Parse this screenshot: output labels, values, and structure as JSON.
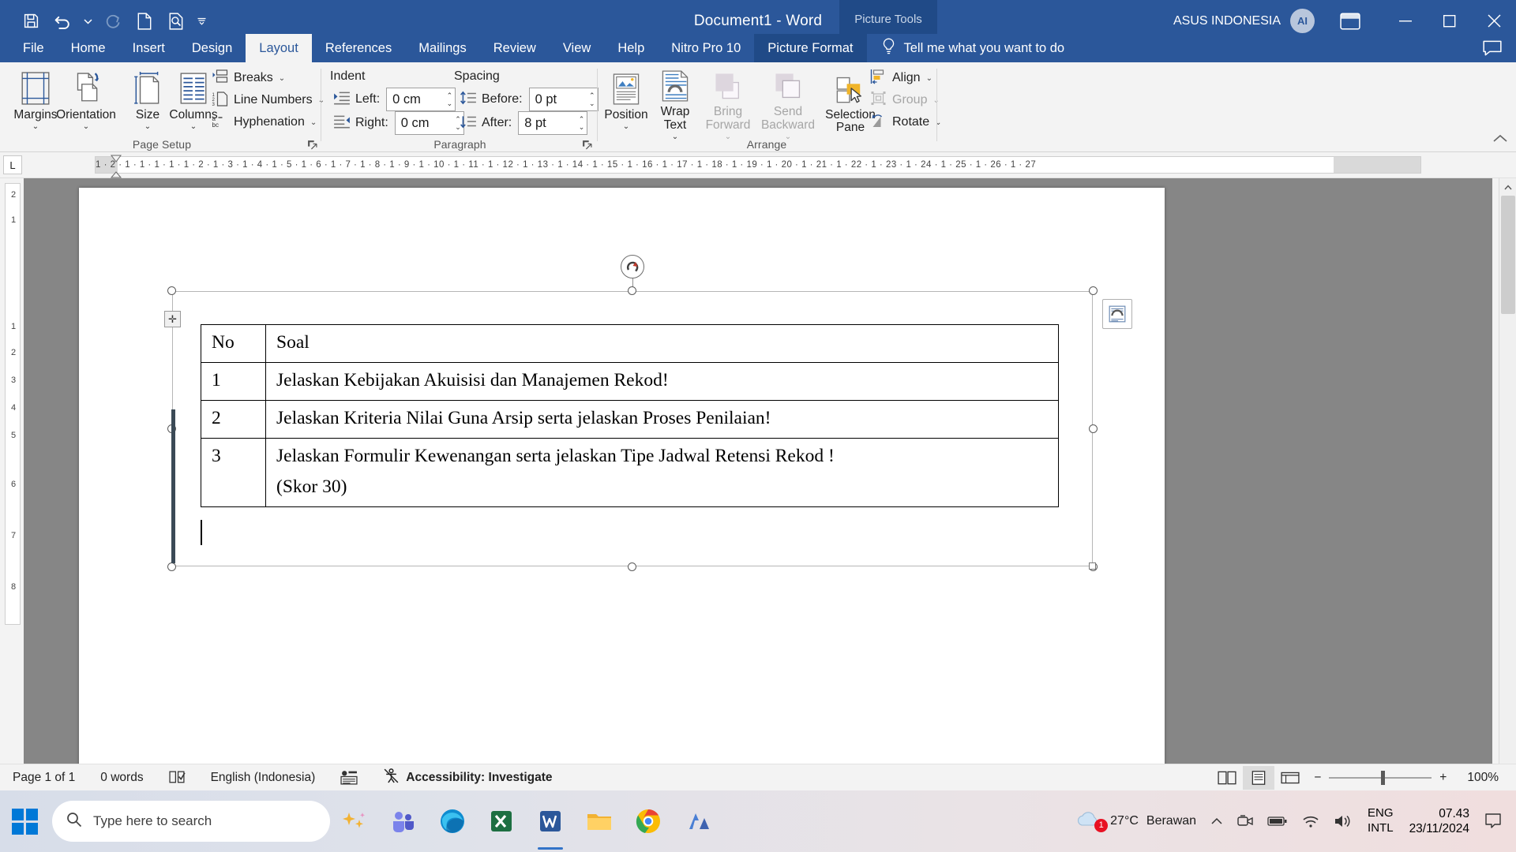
{
  "titlebar": {
    "document_title": "Document1  -  Word",
    "context_tool_label": "Picture Tools",
    "account_name": "ASUS INDONESIA",
    "avatar_initials": "AI",
    "quick_access": [
      {
        "name": "save-icon",
        "label": "Save"
      },
      {
        "name": "undo-icon",
        "label": "Undo"
      },
      {
        "name": "undo-dropdown-icon",
        "label": "Undo options"
      },
      {
        "name": "redo-icon",
        "label": "Redo"
      },
      {
        "name": "new-document-icon",
        "label": "New"
      },
      {
        "name": "print-preview-icon",
        "label": "Print Preview and Print"
      },
      {
        "name": "customize-qat-icon",
        "label": "Customize Quick Access Toolbar"
      }
    ],
    "ribbon_display_options": "Ribbon Display Options",
    "minimize": "Minimize",
    "restore": "Restore Down",
    "close": "Close"
  },
  "tabs": [
    {
      "label": "File",
      "active": false,
      "contextual": false
    },
    {
      "label": "Home",
      "active": false,
      "contextual": false
    },
    {
      "label": "Insert",
      "active": false,
      "contextual": false
    },
    {
      "label": "Design",
      "active": false,
      "contextual": false
    },
    {
      "label": "Layout",
      "active": true,
      "contextual": false
    },
    {
      "label": "References",
      "active": false,
      "contextual": false
    },
    {
      "label": "Mailings",
      "active": false,
      "contextual": false
    },
    {
      "label": "Review",
      "active": false,
      "contextual": false
    },
    {
      "label": "View",
      "active": false,
      "contextual": false
    },
    {
      "label": "Help",
      "active": false,
      "contextual": false
    },
    {
      "label": "Nitro Pro 10",
      "active": false,
      "contextual": false
    },
    {
      "label": "Picture Format",
      "active": false,
      "contextual": true
    }
  ],
  "tell_me": {
    "label": "Tell me what you want to do",
    "icon": "lightbulb-icon"
  },
  "comments": {
    "label": "Comments",
    "icon": "comment-icon"
  },
  "ribbon": {
    "groups": [
      {
        "name": "Page Setup",
        "title": "Page Setup",
        "big_buttons": [
          {
            "label": "Margins",
            "icon": "margins-icon",
            "has_chevron": true,
            "disabled": false
          },
          {
            "label": "Orientation",
            "icon": "orientation-icon",
            "has_chevron": true,
            "disabled": false
          },
          {
            "label": "Size",
            "icon": "page-size-icon",
            "has_chevron": true,
            "disabled": false
          },
          {
            "label": "Columns",
            "icon": "columns-icon",
            "has_chevron": true,
            "disabled": false
          }
        ],
        "small_buttons": [
          {
            "label": "Breaks",
            "icon": "breaks-icon",
            "has_chevron": true,
            "disabled": false
          },
          {
            "label": "Line Numbers",
            "icon": "line-numbers-icon",
            "has_chevron": true,
            "disabled": false
          },
          {
            "label": "Hyphenation",
            "icon": "hyphenation-icon",
            "has_chevron": true,
            "disabled": false
          }
        ]
      },
      {
        "name": "Paragraph",
        "title": "Paragraph",
        "sections": [
          "Indent",
          "Spacing"
        ],
        "fields": [
          {
            "label": "Left:",
            "value": "0 cm",
            "icon": "indent-left-icon"
          },
          {
            "label": "Right:",
            "value": "0 cm",
            "icon": "indent-right-icon"
          },
          {
            "label": "Before:",
            "value": "0 pt",
            "icon": "spacing-before-icon"
          },
          {
            "label": "After:",
            "value": "8 pt",
            "icon": "spacing-after-icon"
          }
        ]
      },
      {
        "name": "Arrange",
        "title": "Arrange",
        "big_buttons": [
          {
            "label": "Position",
            "icon": "position-icon",
            "has_chevron": true,
            "disabled": false
          },
          {
            "label": "Wrap Text",
            "icon": "wrap-text-icon",
            "has_chevron": true,
            "disabled": false
          },
          {
            "label": "Bring Forward",
            "icon": "bring-forward-icon",
            "has_chevron": true,
            "disabled": true
          },
          {
            "label": "Send Backward",
            "icon": "send-backward-icon",
            "has_chevron": true,
            "disabled": true
          },
          {
            "label": "Selection Pane",
            "icon": "selection-pane-icon",
            "has_chevron": false,
            "disabled": false
          }
        ],
        "small_buttons": [
          {
            "label": "Align",
            "icon": "align-icon",
            "has_chevron": true,
            "disabled": false
          },
          {
            "label": "Group",
            "icon": "group-icon",
            "has_chevron": true,
            "disabled": true
          },
          {
            "label": "Rotate",
            "icon": "rotate-icon",
            "has_chevron": true,
            "disabled": false
          }
        ]
      }
    ],
    "collapse_ribbon": "Collapse the Ribbon"
  },
  "ruler": {
    "tab_stop_selector": "L",
    "horizontal_marks": "1 · 2 · 1 · 1 · 1 · 1 · 1 · 2 · 1 · 3 · 1 · 4 · 1 · 5 · 1 · 6 · 1 · 7 · 1 · 8 · 1 · 9 · 1 · 10 · 1 · 11 · 1 · 12 · 1 · 13 · 1 · 14 · 1 · 15 · 1 · 16 · 1 · 17 · 1 · 18 · 1 · 19 · 1 · 20 · 1 · 21 · 1 · 22 · 1 · 23 · 1 · 24 · 1 · 25 · 1 · 26 · 1 · 27",
    "vertical_marks": [
      "2",
      "1",
      "1",
      "1",
      "2",
      "3",
      "4",
      "5",
      "6",
      "7",
      "8"
    ]
  },
  "document": {
    "table": {
      "headers": [
        "No",
        "Soal"
      ],
      "rows": [
        {
          "no": "1",
          "soal": "Jelaskan Kebijakan Akuisisi dan Manajemen Rekod!"
        },
        {
          "no": "2",
          "soal": "Jelaskan Kriteria Nilai Guna Arsip serta jelaskan Proses Penilaian!"
        },
        {
          "no": "3",
          "soal": "Jelaskan Formulir Kewenangan serta jelaskan Tipe Jadwal Retensi Rekod !",
          "soal_line2": "(Skor 30)"
        }
      ]
    },
    "layout_options_label": "Layout Options",
    "move_handle_label": "Move Table",
    "rotate_handle_label": "Rotate"
  },
  "statusbar": {
    "page": "Page 1 of 1",
    "words": "0 words",
    "proofing_icon": "spelling-check-icon",
    "language": "English (Indonesia)",
    "macro_icon": "macro-recording-icon",
    "accessibility": "Accessibility: Investigate",
    "accessibility_icon": "accessibility-icon",
    "views": [
      {
        "name": "read-mode-view",
        "active": false
      },
      {
        "name": "print-layout-view",
        "active": true
      },
      {
        "name": "web-layout-view",
        "active": false
      }
    ],
    "zoom_out": "−",
    "zoom_in": "+",
    "zoom_level": "100%"
  },
  "taskbar": {
    "search_placeholder": "Type here to search",
    "apps": [
      {
        "name": "taskbar-copilot-icon",
        "running": false
      },
      {
        "name": "taskbar-teams-icon",
        "running": false
      },
      {
        "name": "taskbar-edge-icon",
        "running": false
      },
      {
        "name": "taskbar-excel-icon",
        "running": false
      },
      {
        "name": "taskbar-word-icon",
        "running": true
      },
      {
        "name": "taskbar-file-explorer-icon",
        "running": false
      },
      {
        "name": "taskbar-chrome-icon",
        "running": false
      },
      {
        "name": "taskbar-app-icon",
        "running": false
      }
    ],
    "weather": {
      "temperature": "27°C",
      "condition": "Berawan",
      "badge": "1",
      "icon": "cloud-icon"
    },
    "tray_icons": [
      {
        "name": "show-hidden-icons-chevron"
      },
      {
        "name": "camera-icon"
      },
      {
        "name": "battery-icon"
      },
      {
        "name": "wifi-icon"
      },
      {
        "name": "volume-icon"
      }
    ],
    "keyboard_layout": {
      "line1": "ENG",
      "line2": "INTL"
    },
    "clock": {
      "time": "07.43",
      "date": "23/11/2024"
    },
    "notifications_icon": "notification-center-icon"
  },
  "colors": {
    "word_blue": "#2b579a",
    "context_blue": "#204a87",
    "ribbon_bg": "#f3f3f3",
    "canvas_gray": "#868686",
    "accent_orange": "#f2b233"
  }
}
